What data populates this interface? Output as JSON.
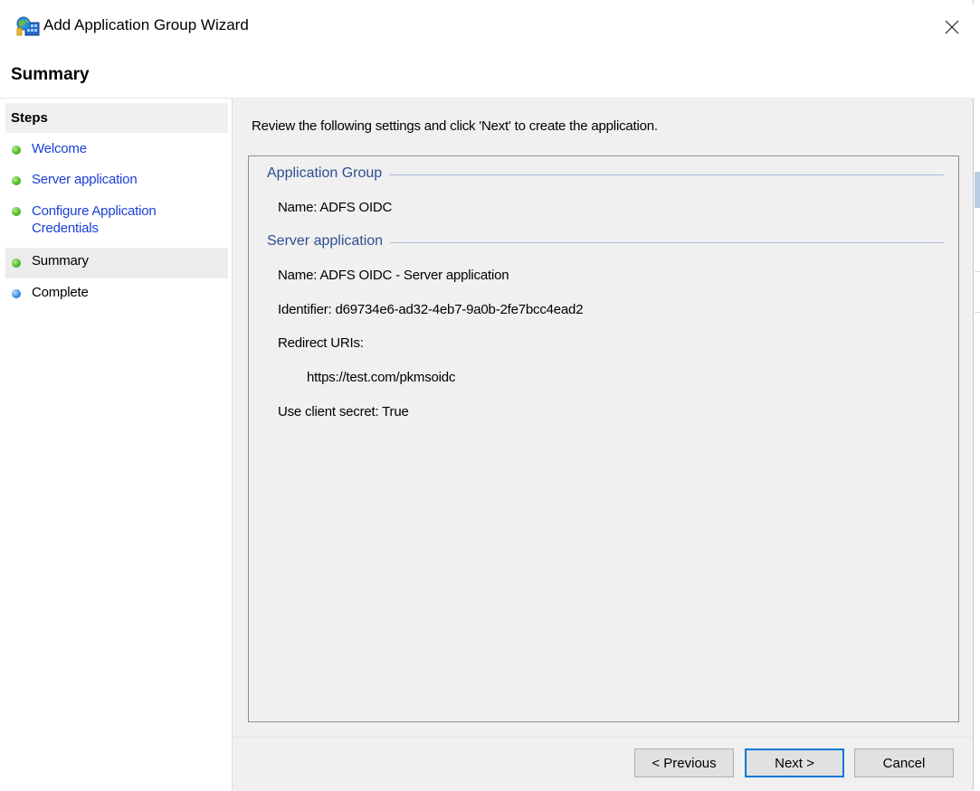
{
  "window": {
    "title": "Add Application Group Wizard",
    "close_symbol": "✕"
  },
  "page": {
    "title": "Summary"
  },
  "steps": {
    "header": "Steps",
    "items": [
      {
        "label": "Welcome",
        "status": "done"
      },
      {
        "label": "Server application",
        "status": "done"
      },
      {
        "label": "Configure Application Credentials",
        "status": "done"
      },
      {
        "label": "Summary",
        "status": "current"
      },
      {
        "label": "Complete",
        "status": "pending"
      }
    ]
  },
  "main": {
    "instruction": "Review the following settings and click 'Next' to create the application.",
    "application_group": {
      "title": "Application Group",
      "name": "Name: ADFS OIDC"
    },
    "server_application": {
      "title": "Server application",
      "name": "Name: ADFS OIDC - Server application",
      "identifier": "Identifier: d69734e6-ad32-4eb7-9a0b-2fe7bcc4ead2",
      "redirect_uris_label": "Redirect URIs:",
      "redirect_uri": "https://test.com/pkmsoidc",
      "client_secret": "Use client secret: True"
    }
  },
  "buttons": {
    "previous": "< Previous",
    "next": "Next >",
    "cancel": "Cancel"
  },
  "colors": {
    "link": "#1a3fd6",
    "section_title": "#2d4f8f",
    "step_done": "#53bb2c",
    "step_pending": "#3b8fe6",
    "default_button_border": "#0078d7"
  }
}
